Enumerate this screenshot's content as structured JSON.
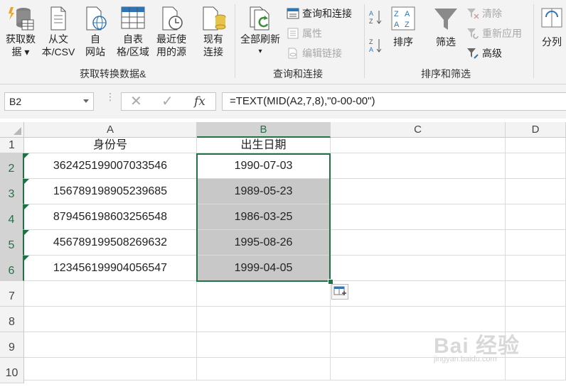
{
  "ribbon": {
    "get_data": {
      "line1": "获取数",
      "line2": "据 ▾"
    },
    "from_text": {
      "line1": "从文",
      "line2": "本/CSV"
    },
    "from_web": {
      "line1": "自",
      "line2": "网站"
    },
    "from_table": {
      "line1": "自表",
      "line2": "格/区域"
    },
    "recent": {
      "line1": "最近使",
      "line2": "用的源"
    },
    "existing": {
      "line1": "现有",
      "line2": "连接"
    },
    "group1_label": "获取转换数据&",
    "refresh_all": {
      "line1": "全部刷新",
      "line2": "▾"
    },
    "queries_connections": "查询和连接",
    "properties": "属性",
    "edit_links": "编辑链接",
    "group2_label": "查询和连接",
    "sort": "排序",
    "filter": "筛选",
    "clear": "清除",
    "reapply": "重新应用",
    "advanced": "高级",
    "group3_label": "排序和筛选",
    "split": "分列"
  },
  "formula_bar": {
    "name_box": "B2",
    "fx": "fx",
    "formula": "=TEXT(MID(A2,7,8),\"0-00-00\")"
  },
  "sheet": {
    "columns": [
      "A",
      "B",
      "C",
      "D"
    ],
    "rows": [
      "1",
      "2",
      "3",
      "4",
      "5",
      "6",
      "7",
      "8",
      "9",
      "10"
    ],
    "header_a": "身份号",
    "header_b": "出生日期",
    "ids": [
      "362425199007033546",
      "156789198905239685",
      "879456198603256548",
      "456789199508269632",
      "123456199904056547"
    ],
    "dates": [
      "1990-07-03",
      "1989-05-23",
      "1986-03-25",
      "1995-08-26",
      "1999-04-05"
    ]
  },
  "watermark": {
    "main": "Bai 经验",
    "sub": "jingyan.baidu.com"
  },
  "colors": {
    "accent": "#217346",
    "selection_fill": "#c8c8c8"
  }
}
